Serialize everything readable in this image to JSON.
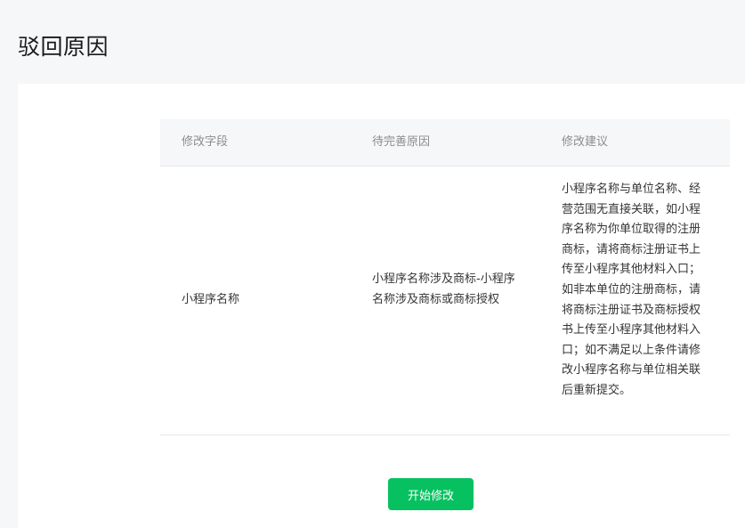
{
  "page": {
    "title": "驳回原因"
  },
  "table": {
    "headers": [
      "修改字段",
      "待完善原因",
      "修改建议"
    ],
    "rows": [
      {
        "field": "小程序名称",
        "reason": "小程序名称涉及商标-小程序名称涉及商标或商标授权",
        "suggestion": "小程序名称与单位名称、经营范围无直接关联，如小程序名称为你单位取得的注册商标，请将商标注册证书上传至小程序其他材料入口；如非本单位的注册商标，请将商标注册证书及商标授权书上传至小程序其他材料入口；如不满足以上条件请修改小程序名称与单位相关联后重新提交。"
      }
    ]
  },
  "actions": {
    "start_edit_label": "开始修改"
  },
  "colors": {
    "accent": "#07c160",
    "page_background": "#f6f7f8",
    "table_header_background": "#f6f7f9"
  }
}
